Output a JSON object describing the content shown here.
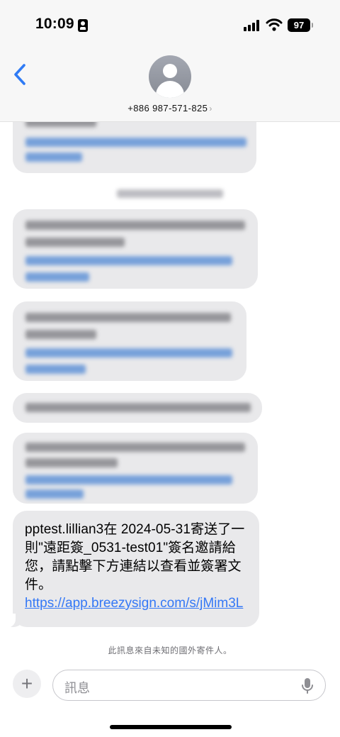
{
  "status_bar": {
    "time": "10:09",
    "battery": "97"
  },
  "header": {
    "contact_number": "+886 987-571-825",
    "chevron": "›"
  },
  "message": {
    "text": "pptest.lillian3在 2024-05-31寄送了一則\"遠距簽_0531-test01\"簽名邀請給您，請點擊下方連結以查看並簽署文件。",
    "link": "https://app.breezysign.com/s/jMim3L"
  },
  "notice": "此訊息來自未知的國外寄件人。",
  "input": {
    "placeholder": "訊息",
    "plus": "+"
  },
  "colors": {
    "bubble": "#e9e9eb",
    "link": "#3478f6",
    "back": "#2f7bf5"
  }
}
